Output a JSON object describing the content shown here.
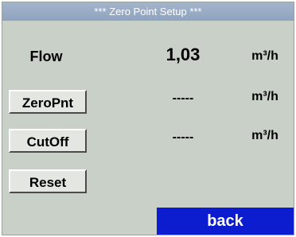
{
  "title": "***   Zero Point Setup ***",
  "rows": [
    {
      "label": "Flow",
      "value": "1,03",
      "unit": "m³/h"
    },
    {
      "label": "ZeroPnt",
      "value": "-----",
      "unit": "m³/h"
    },
    {
      "label": "CutOff",
      "value": "-----",
      "unit": "m³/h"
    },
    {
      "label": "Reset"
    }
  ],
  "back_label": "back"
}
